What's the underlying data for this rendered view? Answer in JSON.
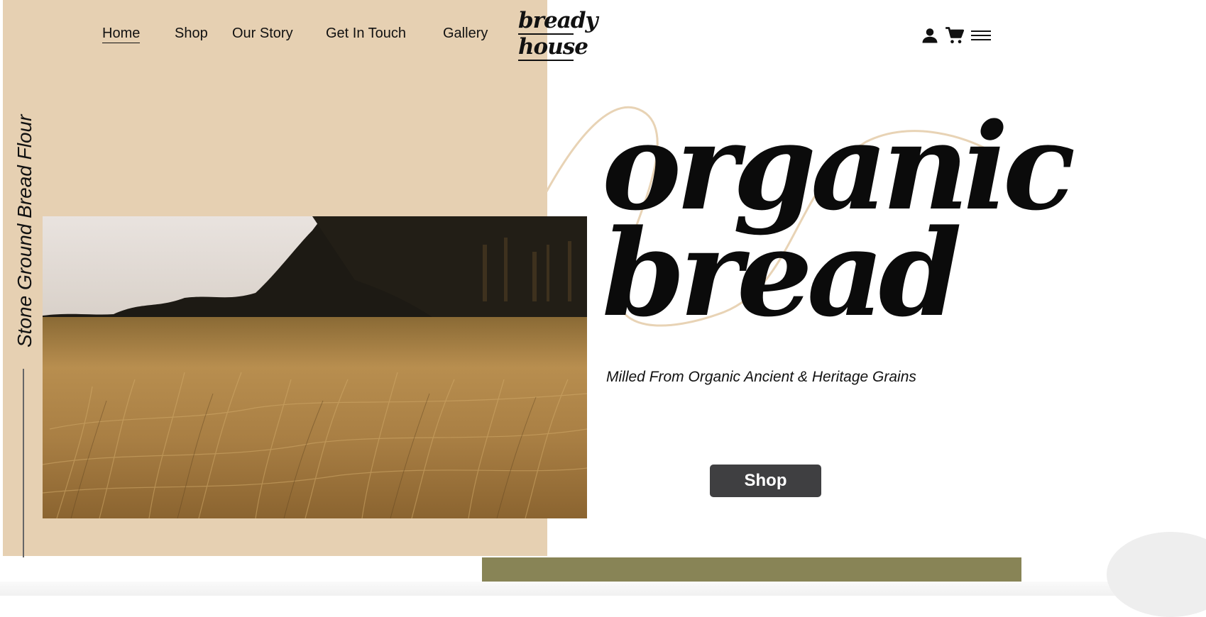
{
  "nav": {
    "items": [
      {
        "label": "Home",
        "active": true
      },
      {
        "label": "Shop"
      },
      {
        "label": "Our Story"
      },
      {
        "label": "Get In Touch"
      },
      {
        "label": "Gallery"
      }
    ]
  },
  "logo": {
    "line1": "bready",
    "line2": "house"
  },
  "header_icons": [
    "user-icon",
    "cart-icon",
    "menu-icon"
  ],
  "sidebar": {
    "vertical_text": "Stone Ground Bread Flour"
  },
  "hero": {
    "headline_line1": "organic",
    "headline_line2": "bread",
    "tagline": "Milled From Organic Ancient & Heritage Grains",
    "cta_label": "Shop"
  },
  "colors": {
    "beige": "#e6d0b2",
    "olive": "#888456",
    "button": "#3f3f41",
    "text": "#111111"
  }
}
